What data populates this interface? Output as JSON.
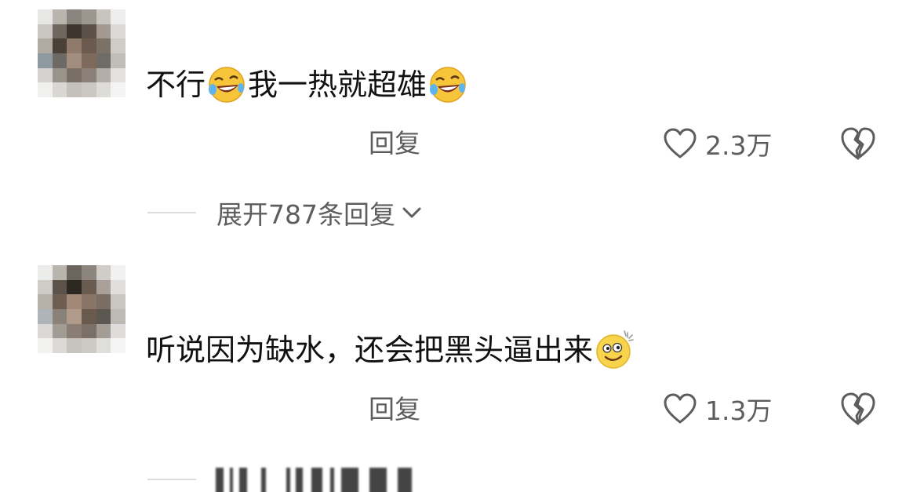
{
  "comments": [
    {
      "text_parts": [
        "不行",
        "我一热就超雄"
      ],
      "emoji": "rofl-emoji",
      "reply_label": "回复",
      "likes": "2.3万",
      "expand_label": "展开787条回复"
    },
    {
      "text": "听说因为缺水，还会把黑头逼出来",
      "emoji": "dizzy-smile-emoji",
      "reply_label": "回复",
      "likes": "1.3万"
    }
  ],
  "colors": {
    "text": "#111111",
    "secondary": "#5d5d5d",
    "divider": "#dcdcdc"
  },
  "icons": [
    "heart-outline-icon",
    "broken-heart-icon",
    "chevron-down-icon"
  ]
}
